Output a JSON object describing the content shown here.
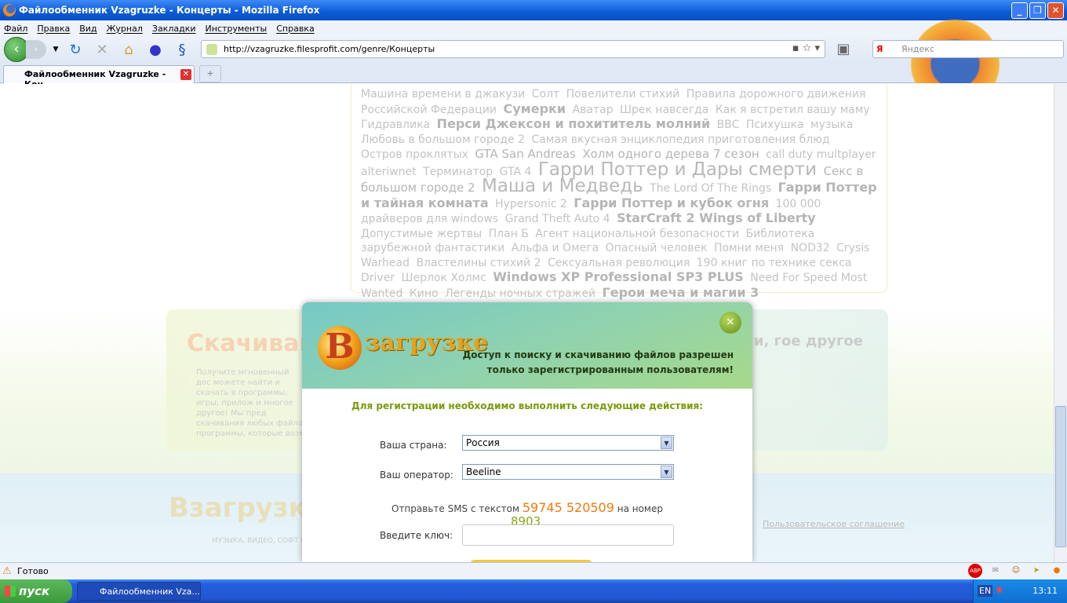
{
  "window": {
    "title": "Файлообменник Vzagruzke - Концерты - Mozilla Firefox"
  },
  "menu": [
    "Файл",
    "Правка",
    "Вид",
    "Журнал",
    "Закладки",
    "Инструменты",
    "Справка"
  ],
  "address": {
    "url": "http://vzagruzke.filesprofit.com/genre/Концерты"
  },
  "search": {
    "engine": "Я",
    "placeholder": "Яндекс"
  },
  "tab": {
    "label": "Файлообменник Vzagruzke - Кон...",
    "new_tab": "+"
  },
  "tags": [
    {
      "t": "Машина времени в джакузи",
      "w": "s"
    },
    {
      "t": "Солт",
      "w": "s"
    },
    {
      "t": "Повелители стихий",
      "w": "s"
    },
    {
      "t": "Правила дорожного движения Российской Федерации",
      "w": "s"
    },
    {
      "t": "Сумерки",
      "w": "b"
    },
    {
      "t": "Аватар",
      "w": "s"
    },
    {
      "t": "Шрек навсегда",
      "w": "s"
    },
    {
      "t": "Как я встретил вашу маму",
      "w": "s"
    },
    {
      "t": "Гидравлика",
      "w": "s"
    },
    {
      "t": "Перси Джексон и похититель молний",
      "w": "b"
    },
    {
      "t": "BBC",
      "w": "s"
    },
    {
      "t": "Психушка",
      "w": "s"
    },
    {
      "t": "музыка",
      "w": "s"
    },
    {
      "t": "Любовь в большом городе 2",
      "w": "s"
    },
    {
      "t": "Самая вкусная энциклопедия приготовления блюд",
      "w": "s"
    },
    {
      "t": "Остров проклятых",
      "w": "s"
    },
    {
      "t": "GTA San Andreas",
      "w": "m"
    },
    {
      "t": "Холм одного дерева 7 сезон",
      "w": "m"
    },
    {
      "t": "call duty multplayer alteriwnet",
      "w": "s"
    },
    {
      "t": "Терминатор",
      "w": "s"
    },
    {
      "t": "GTA 4",
      "w": "s"
    },
    {
      "t": "Гарри Поттер и Дары смерти",
      "w": "xl"
    },
    {
      "t": "Секс в большом городе 2",
      "w": "m"
    },
    {
      "t": "Маша и Медведь",
      "w": "xl"
    },
    {
      "t": "The Lord Of The Rings",
      "w": "s"
    },
    {
      "t": "Гарри Поттер и тайная комната",
      "w": "b"
    },
    {
      "t": "Hypersonic 2",
      "w": "s"
    },
    {
      "t": "Гарри Поттер и кубок огня",
      "w": "b"
    },
    {
      "t": "100 000 драйверов для windows",
      "w": "s"
    },
    {
      "t": "Grand Theft Auto 4",
      "w": "s"
    },
    {
      "t": "StarCraft 2 Wings of Liberty",
      "w": "b"
    },
    {
      "t": "Допустимые жертвы",
      "w": "s"
    },
    {
      "t": "План Б",
      "w": "s"
    },
    {
      "t": "Агент национальной безопасности",
      "w": "s"
    },
    {
      "t": "Библиотека зарубежной фантастики",
      "w": "s"
    },
    {
      "t": "Альфа и Омега",
      "w": "s"
    },
    {
      "t": "Опасный человек",
      "w": "s"
    },
    {
      "t": "Помни меня",
      "w": "s"
    },
    {
      "t": "NOD32",
      "w": "s"
    },
    {
      "t": "Crysis Warhead",
      "w": "s"
    },
    {
      "t": "Властелины стихий 2",
      "w": "s"
    },
    {
      "t": "Сексуальная революция",
      "w": "s"
    },
    {
      "t": "190 книг по технике секса",
      "w": "s"
    },
    {
      "t": "Driver",
      "w": "s"
    },
    {
      "t": "Шерлок Холмс",
      "w": "s"
    },
    {
      "t": "Windows XP Professional SP3 PLUS",
      "w": "b"
    },
    {
      "t": "Need For Speed Most Wanted",
      "w": "s"
    },
    {
      "t": "Кино",
      "w": "s"
    },
    {
      "t": "Легенды ночных стражей",
      "w": "s"
    },
    {
      "t": "Герои меча и магии 3",
      "w": "b"
    }
  ],
  "promo": {
    "heading": "Скачивайт",
    "text": "Получите мгновенный дос можете найти и скачать в программы, игры, прилож и многое другое! Мы пред скачивания любых файло программы, которые возм",
    "right": "телепередачи, гое другое"
  },
  "footer": {
    "logo": "Взагрузке",
    "sub": "МУЗЫКА, ВИДЕО, СОФТ И М",
    "agreement": "Пользовательское соглашение"
  },
  "modal": {
    "logo_letter": "В",
    "logo_text": "загрузке",
    "header_text_1": "Доступ к поиску и скачиванию файлов разрешен",
    "header_text_2": "только зарегистрированным пользователям!",
    "close": "×",
    "instructions": "Для регистрации необходимо выполнить следующие действия:",
    "country_label": "Ваша страна:",
    "country_value": "Россия",
    "operator_label": "Ваш оператор:",
    "operator_value": "Beeline",
    "sms_prefix": "Отправьте SMS с текстом",
    "sms_code": "59745 520509",
    "sms_suffix": "на номер",
    "sms_number": "8903",
    "key_label": "Введите ключ:",
    "key_value": ""
  },
  "status": {
    "text": "Готово"
  },
  "taskbar": {
    "start": "пуск",
    "task": "Файлообменник Vza...",
    "lang": "EN",
    "clock": "13:11"
  }
}
